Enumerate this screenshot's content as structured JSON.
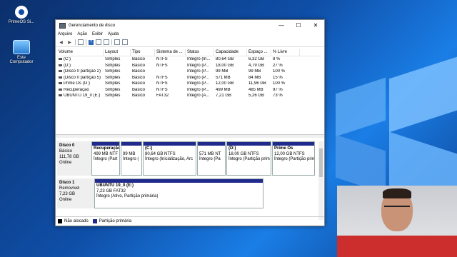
{
  "desktop": {
    "icons": [
      {
        "label": "PrimeOS Si...",
        "icon": "primeos-icon"
      },
      {
        "label": "Este Computador",
        "icon": "computer-icon"
      }
    ]
  },
  "window": {
    "title": "Gerenciamento de disco",
    "controls": {
      "minimize": "—",
      "maximize": "☐",
      "close": "✕"
    },
    "menu": [
      "Arquivo",
      "Ação",
      "Exibir",
      "Ajuda"
    ],
    "toolbar_icons": [
      "back-icon",
      "forward-icon",
      "list-view-icon",
      "help-icon",
      "properties-icon",
      "refresh-icon",
      "new-icon",
      "disk-icon"
    ]
  },
  "volume_table": {
    "columns": [
      "Volume",
      "Layout",
      "Tipo",
      "Sistema de ...",
      "Status",
      "Capacidade",
      "Espaço ...",
      "% Livre"
    ],
    "rows": [
      [
        "(C:)",
        "Simples",
        "Básico",
        "NTFS",
        "Íntegro (In...",
        "80,64 GB",
        "6,32 GB",
        "8 %"
      ],
      [
        "(D:)",
        "Simples",
        "Básico",
        "NTFS",
        "Íntegro (P...",
        "18,00 GB",
        "4,79 GB",
        "27 %"
      ],
      [
        "(Disco 0 partição 2)",
        "Simples",
        "Básico",
        "",
        "Íntegro (P...",
        "99 MB",
        "99 MB",
        "100 %"
      ],
      [
        "(Disco 0 partição 5)",
        "Simples",
        "Básico",
        "NTFS",
        "Íntegro (P...",
        "571 MB",
        "84 MB",
        "15 %"
      ],
      [
        "Prime Os (G:)",
        "Simples",
        "Básico",
        "NTFS",
        "Íntegro (P...",
        "12,00 GB",
        "11,96 GB",
        "100 %"
      ],
      [
        "Recuperação",
        "Simples",
        "Básico",
        "NTFS",
        "Íntegro (P...",
        "499 MB",
        "485 MB",
        "97 %"
      ],
      [
        "UBUNTU 19_0 (E:)",
        "Simples",
        "Básico",
        "FAT32",
        "Íntegro (A...",
        "7,21 GB",
        "5,26 GB",
        "73 %"
      ]
    ]
  },
  "disks": [
    {
      "name": "Disco 0",
      "type": "Básico",
      "size": "111,78 GB",
      "status": "Online",
      "partitions": [
        {
          "name": "Recuperação",
          "size": "499 MB NTF",
          "status": "Íntegro (Part"
        },
        {
          "name": "",
          "size": "99 MB",
          "status": "Íntegro ("
        },
        {
          "name": "(C:)",
          "size": "80,64 GB NTFS",
          "status": "Íntegro (Inicialização, Arc"
        },
        {
          "name": "",
          "size": "571 MB NT",
          "status": "Íntegro (Pa"
        },
        {
          "name": "(D:)",
          "size": "18,00 GB NTFS",
          "status": "Íntegro (Partição prim"
        },
        {
          "name": "Prime Os",
          "size": "12,00 GB NTFS",
          "status": "Íntegro (Partição prim"
        }
      ]
    },
    {
      "name": "Disco 1",
      "type": "Removível",
      "size": "7,23 GB",
      "status": "Online",
      "partitions": [
        {
          "name": "UBUNTU 19_0  (E:)",
          "size": "7,23 GB FAT32",
          "status": "Íntegro (Ativo, Partição primária)"
        }
      ]
    }
  ],
  "legend": [
    {
      "label": "Não alocado",
      "color": "#000000"
    },
    {
      "label": "Partição primária",
      "color": "#1f2a8c"
    }
  ]
}
